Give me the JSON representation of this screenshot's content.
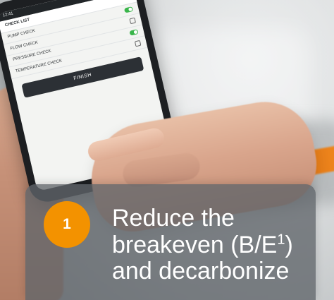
{
  "colors": {
    "badge": "#f39200",
    "overlay": "#60656A",
    "text": "#ffffff",
    "toggle": "#39b54a"
  },
  "phone": {
    "status_left": "12:41",
    "status_right": "▮",
    "header_title": "CHECK LIST",
    "rows": [
      {
        "label": "PUMP CHECK",
        "icon": "toggle-icon"
      },
      {
        "label": "FLOW CHECK",
        "icon": "check-icon"
      },
      {
        "label": "PRESSURE CHECK",
        "icon": "toggle-icon"
      },
      {
        "label": "TEMPERATURE CHECK",
        "icon": "check-icon"
      }
    ],
    "button_label": "FINISH"
  },
  "card": {
    "number": "1",
    "line1": "Reduce the",
    "line2_main": "breakeven (B/E",
    "line2_sup": "1",
    "line2_end": ")",
    "line3": "and decarbonize"
  }
}
